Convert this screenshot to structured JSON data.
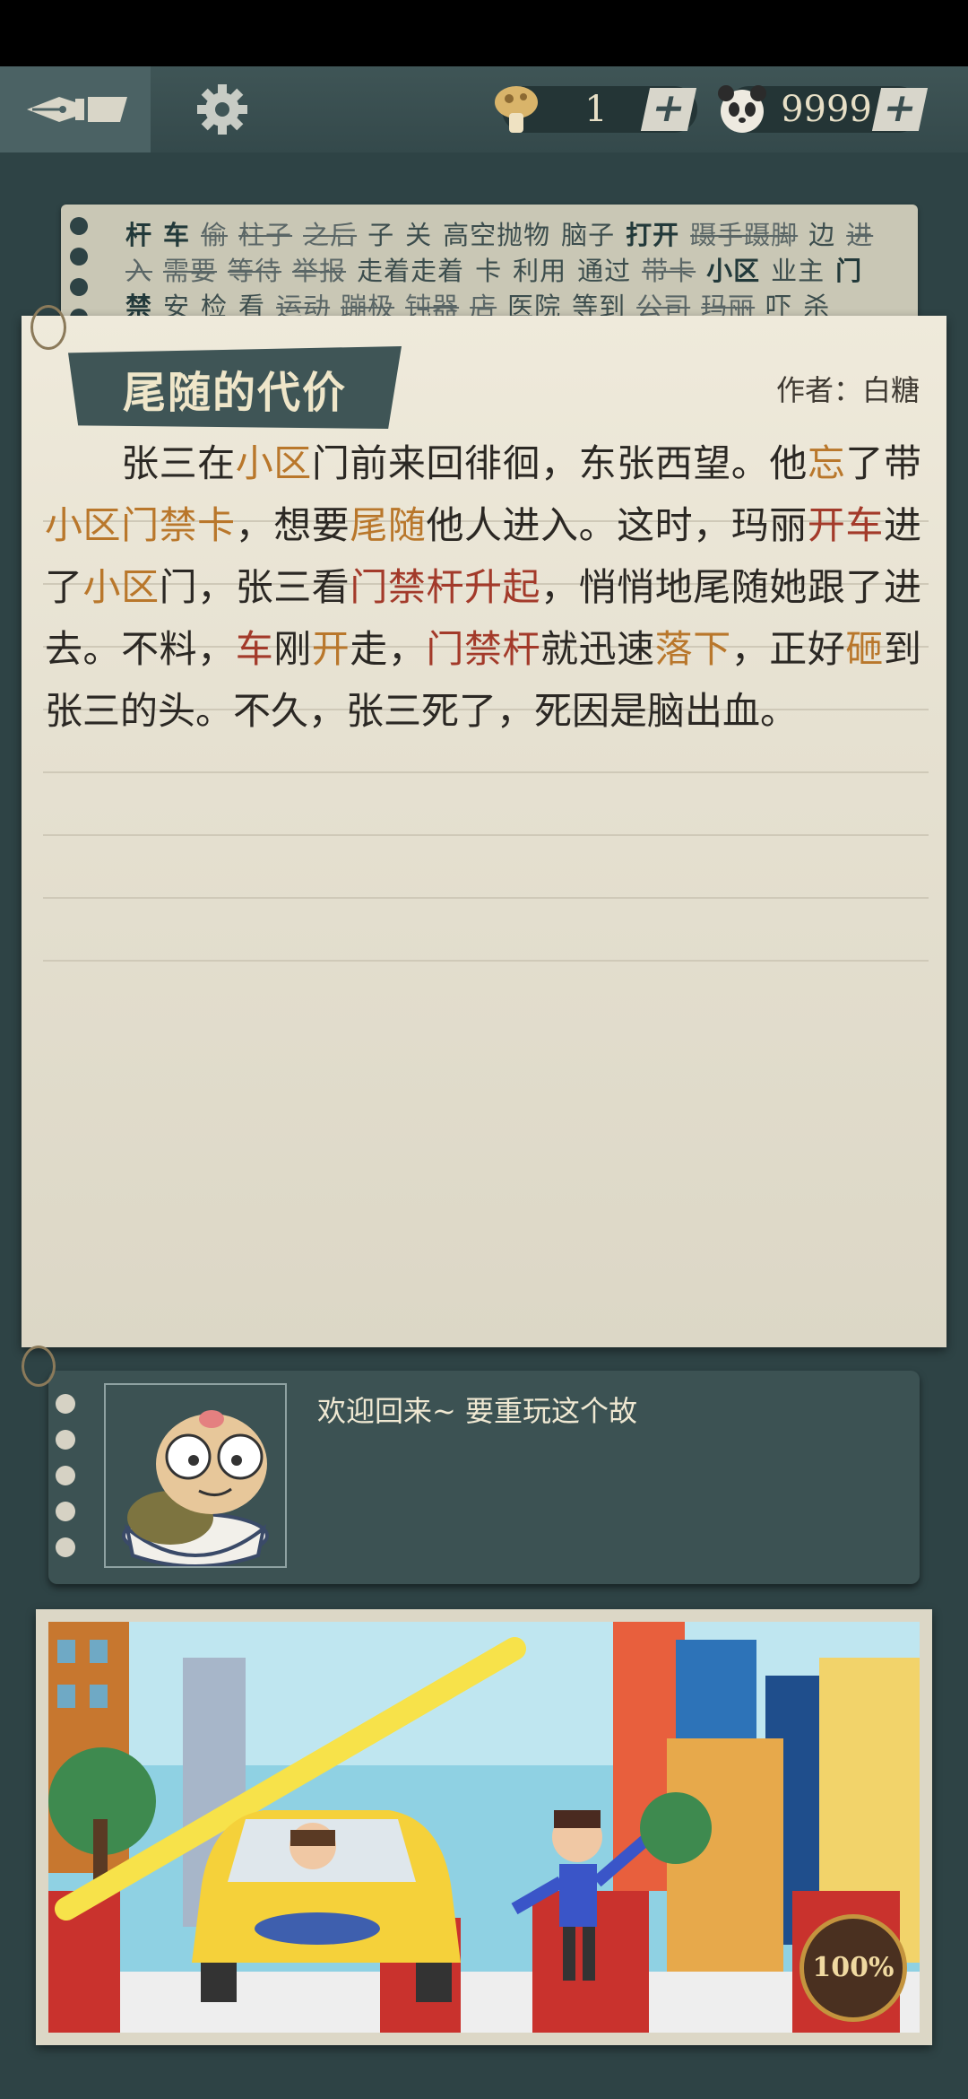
{
  "topbar": {
    "keys": {
      "value": "1",
      "icon": "mushroom-key-icon",
      "plus": "+"
    },
    "coins": {
      "value": "9999",
      "icon": "panda-coin-icon",
      "plus": "+"
    }
  },
  "wordbank": {
    "words": [
      {
        "t": "杆",
        "c": "dk"
      },
      {
        "t": "车",
        "c": "dk"
      },
      {
        "t": "偷",
        "c": "st"
      },
      {
        "t": "柱子",
        "c": "st"
      },
      {
        "t": "之后",
        "c": "st"
      },
      {
        "t": "子",
        "c": ""
      },
      {
        "t": "关",
        "c": ""
      },
      {
        "t": "高空抛物",
        "c": ""
      },
      {
        "t": "脑子",
        "c": ""
      },
      {
        "t": "打开",
        "c": "dk"
      },
      {
        "t": "蹑手蹑脚",
        "c": "st"
      },
      {
        "t": "边",
        "c": ""
      },
      {
        "t": "进入",
        "c": "st"
      },
      {
        "t": "需要",
        "c": "st"
      },
      {
        "t": "等待",
        "c": "st"
      },
      {
        "t": "举报",
        "c": "st"
      },
      {
        "t": "走着走着",
        "c": ""
      },
      {
        "t": "卡",
        "c": ""
      },
      {
        "t": "利用",
        "c": ""
      },
      {
        "t": "通过",
        "c": ""
      },
      {
        "t": "带卡",
        "c": "st"
      },
      {
        "t": "小区",
        "c": "dk"
      },
      {
        "t": "业主",
        "c": ""
      },
      {
        "t": "门禁",
        "c": "dk"
      },
      {
        "t": "安",
        "c": ""
      },
      {
        "t": "检",
        "c": ""
      },
      {
        "t": "看",
        "c": ""
      },
      {
        "t": "运动",
        "c": "st"
      },
      {
        "t": "蹦极",
        "c": "st"
      },
      {
        "t": "钝器",
        "c": "st"
      },
      {
        "t": "店",
        "c": "st"
      },
      {
        "t": "医院",
        "c": ""
      },
      {
        "t": "等到",
        "c": ""
      },
      {
        "t": "公司",
        "c": "st"
      },
      {
        "t": "玛丽",
        "c": "st"
      },
      {
        "t": "吓",
        "c": ""
      },
      {
        "t": "杀",
        "c": ""
      }
    ]
  },
  "story": {
    "title": "尾随的代价",
    "author": "作者：白糖",
    "segments": [
      {
        "t": "　　张三在",
        "c": ""
      },
      {
        "t": "小区",
        "c": "hl"
      },
      {
        "t": "门前来回徘徊，东张西望。他",
        "c": ""
      },
      {
        "t": "忘",
        "c": "hl"
      },
      {
        "t": "了带",
        "c": ""
      },
      {
        "t": "小区门禁卡",
        "c": "hl"
      },
      {
        "t": "，想要",
        "c": ""
      },
      {
        "t": "尾随",
        "c": "hl"
      },
      {
        "t": "他人进入。这时，玛丽",
        "c": ""
      },
      {
        "t": "开车",
        "c": "hr"
      },
      {
        "t": "进了",
        "c": ""
      },
      {
        "t": "小区",
        "c": "hl"
      },
      {
        "t": "门，张三看",
        "c": ""
      },
      {
        "t": "门禁杆升起",
        "c": "hr"
      },
      {
        "t": "，悄悄地尾随她跟了进去。不料，",
        "c": ""
      },
      {
        "t": "车",
        "c": "hr"
      },
      {
        "t": "刚",
        "c": ""
      },
      {
        "t": "开",
        "c": "hl"
      },
      {
        "t": "走，",
        "c": ""
      },
      {
        "t": "门禁杆",
        "c": "hr"
      },
      {
        "t": "就迅速",
        "c": ""
      },
      {
        "t": "落下",
        "c": "hl"
      },
      {
        "t": "，正好",
        "c": ""
      },
      {
        "t": "砸",
        "c": "hl"
      },
      {
        "t": "到张三的头。不久，张三死了，死因是脑出血。",
        "c": ""
      }
    ]
  },
  "dialog": {
    "text": "欢迎回来~ 要重玩这个故",
    "avatar": "turtle-in-bowl-avatar"
  },
  "scene": {
    "progress": "100%",
    "illustration": "car-gate-illustration"
  },
  "colors": {
    "accent_orange": "#b9772b",
    "accent_red": "#a33a2a",
    "panel": "#3c5253"
  }
}
